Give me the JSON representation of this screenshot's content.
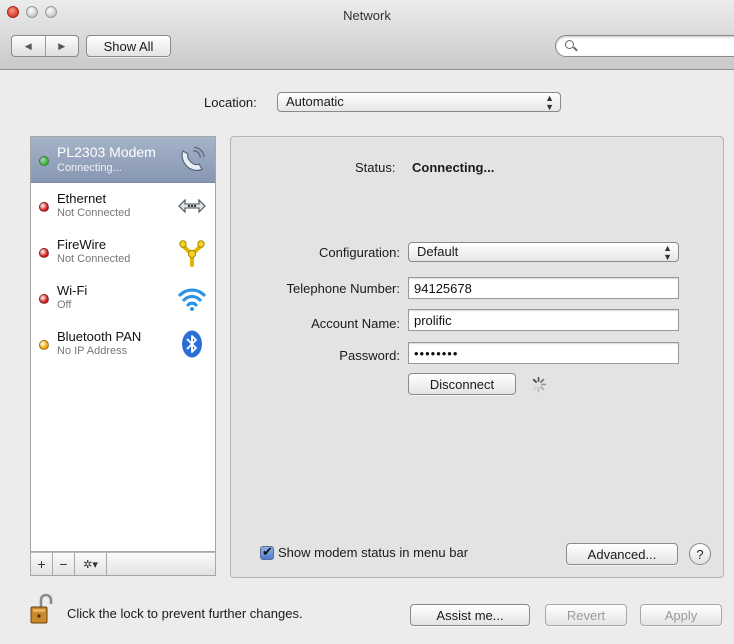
{
  "window": {
    "title": "Network"
  },
  "toolbar": {
    "show_all_label": "Show All",
    "search_placeholder": "",
    "back_glyph": "◀",
    "forward_glyph": "▶"
  },
  "location": {
    "label": "Location:",
    "value": "Automatic"
  },
  "services": [
    {
      "name": "PL2303 Modem",
      "status": "Connecting...",
      "dot_color": "#3cbf3c",
      "icon": "modem-phone-icon",
      "selected": true
    },
    {
      "name": "Ethernet",
      "status": "Not Connected",
      "dot_color": "#d01f1f",
      "icon": "ethernet-arrows-icon",
      "selected": false
    },
    {
      "name": "FireWire",
      "status": "Not Connected",
      "dot_color": "#d01f1f",
      "icon": "firewire-icon",
      "selected": false
    },
    {
      "name": "Wi-Fi",
      "status": "Off",
      "dot_color": "#d01f1f",
      "icon": "wifi-icon",
      "selected": false
    },
    {
      "name": "Bluetooth PAN",
      "status": "No IP Address",
      "dot_color": "#f0a400",
      "icon": "bluetooth-icon",
      "selected": false
    }
  ],
  "sidebar_tools": {
    "add": "+",
    "remove": "−",
    "gear": "✲▾"
  },
  "detail": {
    "status_label": "Status:",
    "status_value": "Connecting...",
    "configuration_label": "Configuration:",
    "configuration_value": "Default",
    "telephone_label": "Telephone Number:",
    "telephone_value": "94125678",
    "account_label": "Account Name:",
    "account_value": "prolific",
    "password_label": "Password:",
    "password_value": "••••••••",
    "disconnect_label": "Disconnect",
    "show_modem_label": "Show modem status in menu bar",
    "show_modem_checked": true,
    "advanced_label": "Advanced...",
    "help_label": "?"
  },
  "footer": {
    "lock_text": "Click the lock to prevent further changes.",
    "assist_label": "Assist me...",
    "revert_label": "Revert",
    "apply_label": "Apply"
  }
}
